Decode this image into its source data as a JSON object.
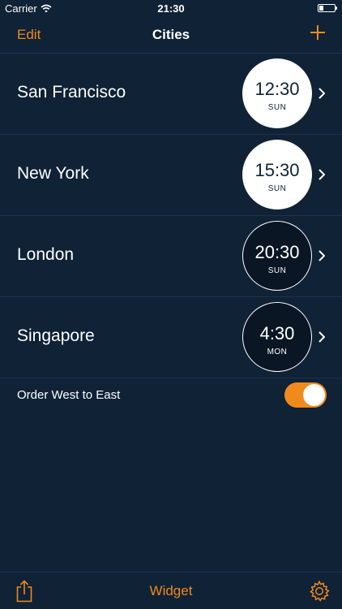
{
  "status_bar": {
    "carrier": "Carrier",
    "time": "21:30",
    "wifi_icon": "wifi-icon",
    "battery_icon": "battery-icon"
  },
  "nav": {
    "edit_label": "Edit",
    "title": "Cities",
    "add_icon": "plus-icon"
  },
  "cities": [
    {
      "name": "San Francisco",
      "time": "12:30",
      "day": "SUN",
      "mode": "day"
    },
    {
      "name": "New York",
      "time": "15:30",
      "day": "SUN",
      "mode": "day"
    },
    {
      "name": "London",
      "time": "20:30",
      "day": "SUN",
      "mode": "night"
    },
    {
      "name": "Singapore",
      "time": "4:30",
      "day": "MON",
      "mode": "night"
    }
  ],
  "order": {
    "label": "Order West to East",
    "enabled": true
  },
  "tab_bar": {
    "share_icon": "share-icon",
    "widget_label": "Widget",
    "settings_icon": "gear-icon"
  },
  "colors": {
    "background": "#0f2236",
    "accent": "#f08a1c",
    "separator": "#1e3349"
  }
}
